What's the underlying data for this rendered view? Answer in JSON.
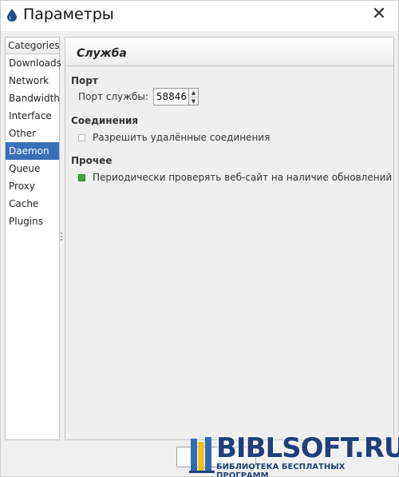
{
  "window": {
    "title": "Параметры",
    "close_symbol": "✕"
  },
  "sidebar": {
    "header": "Categories",
    "items": [
      {
        "label": "Downloads"
      },
      {
        "label": "Network"
      },
      {
        "label": "Bandwidth"
      },
      {
        "label": "Interface"
      },
      {
        "label": "Other"
      },
      {
        "label": "Daemon",
        "selected": true
      },
      {
        "label": "Queue"
      },
      {
        "label": "Proxy"
      },
      {
        "label": "Cache"
      },
      {
        "label": "Plugins"
      }
    ]
  },
  "panel": {
    "title": "Служба",
    "port_section": {
      "title": "Порт",
      "label": "Порт службы:",
      "value": "58846",
      "up": "▲",
      "down": "▼"
    },
    "connections_section": {
      "title": "Соединения",
      "allow_remote": {
        "label": "Разрешить удалённые соединения",
        "checked": false
      }
    },
    "other_section": {
      "title": "Прочее",
      "check_updates": {
        "label": "Периодически проверять веб-сайт на наличие обновлений",
        "checked": true
      }
    }
  },
  "watermark": {
    "brand": "BIBLSOFT.RU",
    "tagline": "БИБЛИОТЕКА БЕСПЛАТНЫХ ПРОГРАММ"
  },
  "colors": {
    "selection": "#3a6fb8",
    "checkbox_checked": "#3fa33f",
    "watermark": "#1e3f7a"
  }
}
